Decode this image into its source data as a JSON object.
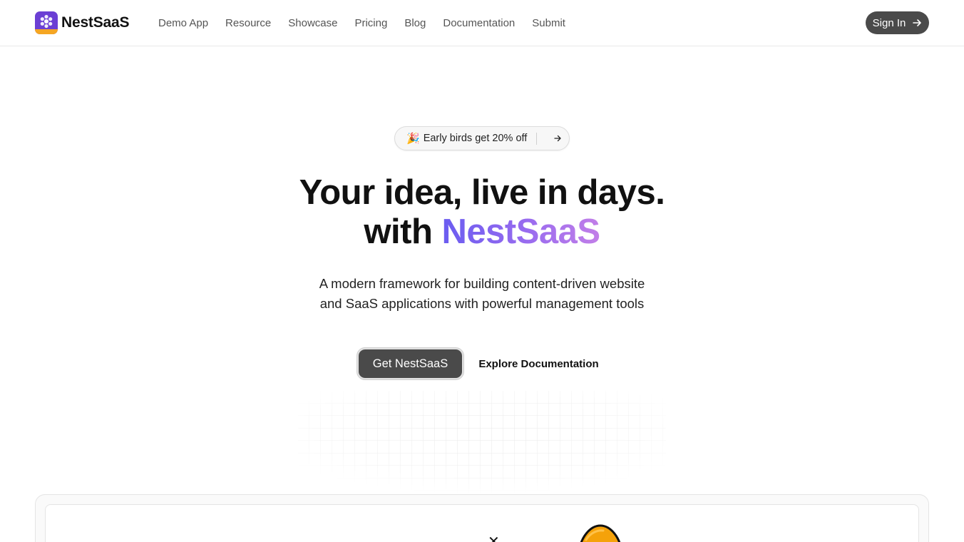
{
  "header": {
    "brand": "NestSaaS",
    "nav": [
      "Demo App",
      "Resource",
      "Showcase",
      "Pricing",
      "Blog",
      "Documentation",
      "Submit"
    ],
    "signin_label": "Sign In"
  },
  "promo": {
    "icon": "party-popper-icon",
    "text": "Early birds get 20% off"
  },
  "hero": {
    "line1": "Your idea, live in days.",
    "line2_prefix": "with",
    "line2_brand": "NestSaaS",
    "sub_line1": "A modern framework for building content-driven website",
    "sub_line2": "and SaaS applications with powerful management tools"
  },
  "cta": {
    "primary": "Get NestSaaS",
    "secondary": "Explore Documentation"
  },
  "colors": {
    "brand_purple": "#6b3fd4",
    "brand_orange": "#f5a623",
    "dark_button": "#4a4a4a",
    "gradient_start": "#6a5cf0",
    "gradient_end": "#c27fe8"
  }
}
